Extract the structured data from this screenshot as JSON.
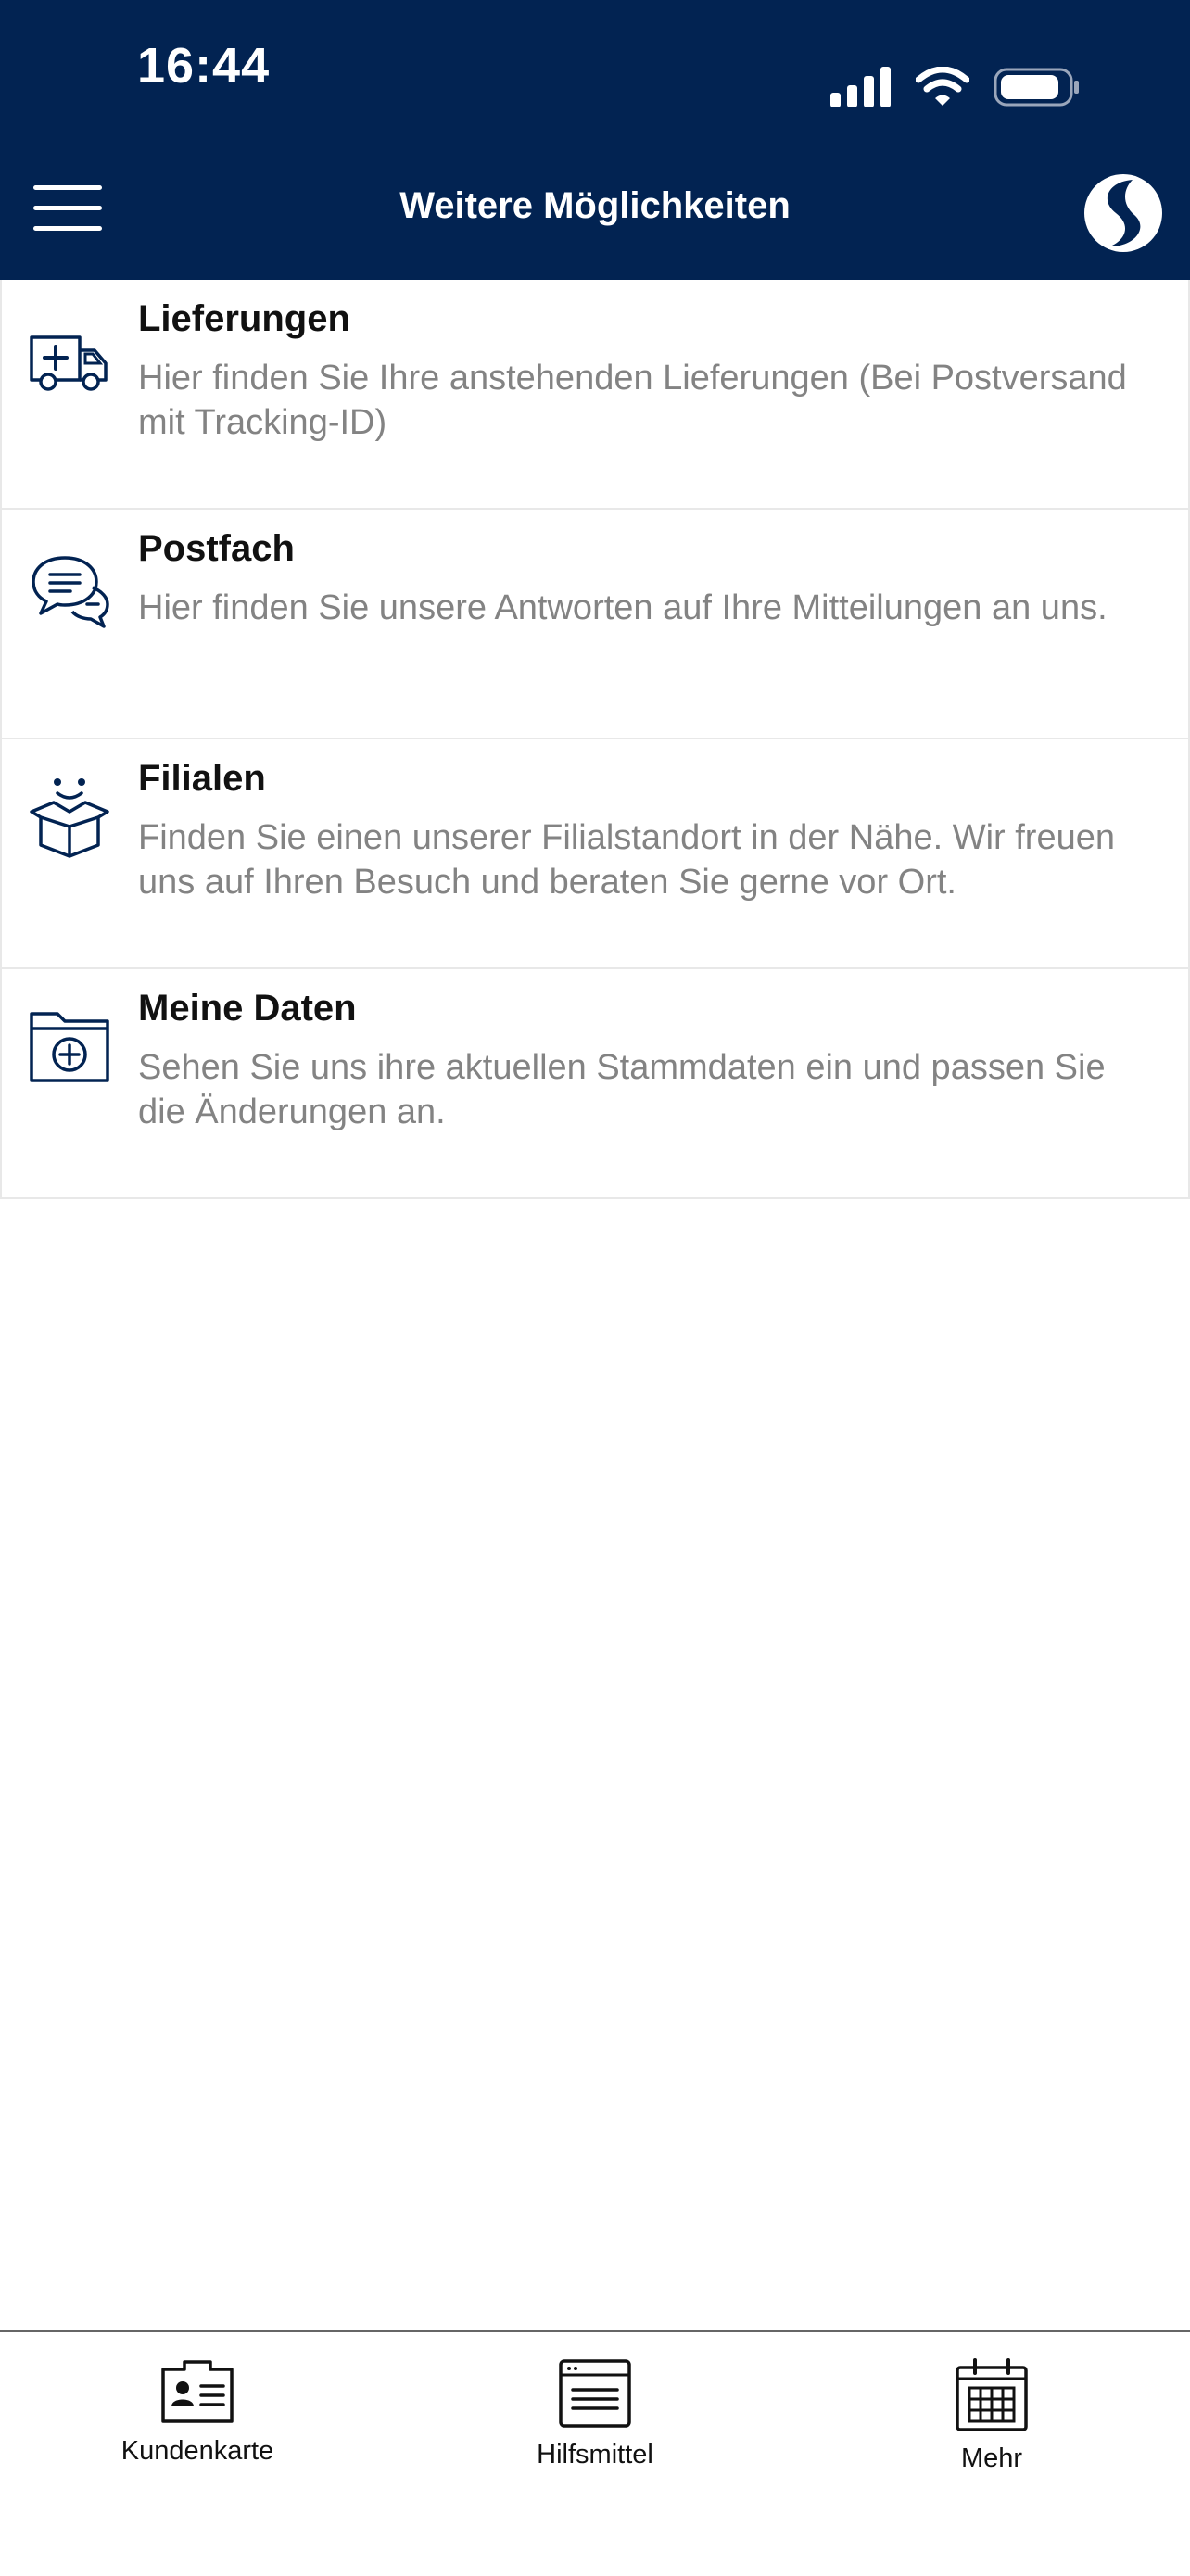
{
  "status_bar": {
    "time": "16:44"
  },
  "header": {
    "title": "Weitere Möglichkeiten"
  },
  "items": [
    {
      "icon": "delivery-van-icon",
      "title": "Lieferungen",
      "description": "Hier finden Sie Ihre anstehenden Lieferungen (Bei Postversand mit Tracking-ID)"
    },
    {
      "icon": "chat-bubbles-icon",
      "title": "Postfach",
      "description": "Hier finden Sie unsere Antworten auf Ihre Mitteilungen an uns."
    },
    {
      "icon": "smiling-box-icon",
      "title": "Filialen",
      "description": "Finden Sie einen unserer Filialstandort in der Nähe. Wir freuen uns auf Ihren Besuch und beraten Sie gerne vor Ort."
    },
    {
      "icon": "folder-plus-icon",
      "title": "Meine Daten",
      "description": "Sehen Sie uns ihre aktuellen Stammdaten ein und passen Sie die Änderungen an."
    }
  ],
  "tabbar": {
    "tabs": [
      {
        "icon": "customer-card-icon",
        "label": "Kundenkarte"
      },
      {
        "icon": "document-window-icon",
        "label": "Hilfsmittel"
      },
      {
        "icon": "calendar-icon",
        "label": "Mehr"
      }
    ]
  },
  "colors": {
    "header_bg": "#022352",
    "icon_stroke": "#022352",
    "description_text": "#838383"
  }
}
